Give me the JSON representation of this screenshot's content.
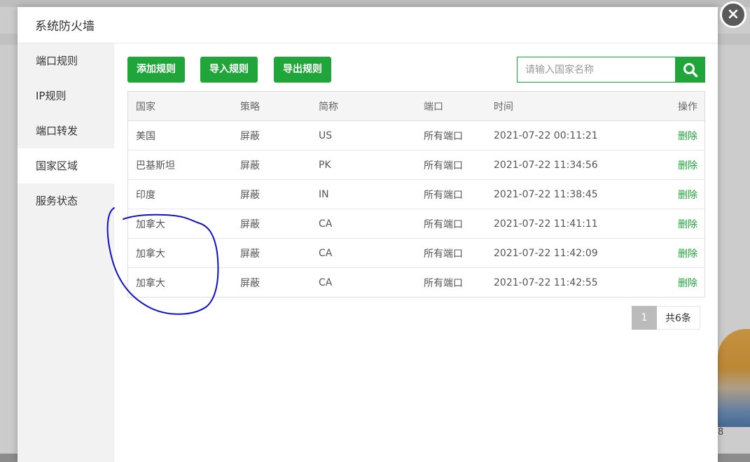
{
  "background": {
    "partial_number": "8"
  },
  "dialog": {
    "title": "系统防火墙",
    "close_symbol": "×"
  },
  "sidebar": {
    "items": [
      {
        "label": "端口规则",
        "active": false
      },
      {
        "label": "IP规则",
        "active": false
      },
      {
        "label": "端口转发",
        "active": false
      },
      {
        "label": "国家区域",
        "active": true
      },
      {
        "label": "服务状态",
        "active": false
      }
    ]
  },
  "toolbar": {
    "add_label": "添加规则",
    "import_label": "导入规则",
    "export_label": "导出规则",
    "search_placeholder": "请输入国家名称"
  },
  "table": {
    "headers": {
      "country": "国家",
      "policy": "策略",
      "abbr": "简称",
      "port": "端口",
      "time": "时间",
      "action": "操作"
    },
    "rows": [
      {
        "country": "美国",
        "policy": "屏蔽",
        "abbr": "US",
        "port": "所有端口",
        "time": "2021-07-22 00:11:21",
        "action": "删除"
      },
      {
        "country": "巴基斯坦",
        "policy": "屏蔽",
        "abbr": "PK",
        "port": "所有端口",
        "time": "2021-07-22 11:34:56",
        "action": "删除"
      },
      {
        "country": "印度",
        "policy": "屏蔽",
        "abbr": "IN",
        "port": "所有端口",
        "time": "2021-07-22 11:38:45",
        "action": "删除"
      },
      {
        "country": "加拿大",
        "policy": "屏蔽",
        "abbr": "CA",
        "port": "所有端口",
        "time": "2021-07-22 11:41:11",
        "action": "删除"
      },
      {
        "country": "加拿大",
        "policy": "屏蔽",
        "abbr": "CA",
        "port": "所有端口",
        "time": "2021-07-22 11:42:09",
        "action": "删除"
      },
      {
        "country": "加拿大",
        "policy": "屏蔽",
        "abbr": "CA",
        "port": "所有端口",
        "time": "2021-07-22 11:42:55",
        "action": "删除"
      }
    ]
  },
  "pagination": {
    "current_page": "1",
    "total_label": "共6条"
  },
  "colors": {
    "accent": "#20a53a",
    "policy_red": "#e00000",
    "annotation_ink": "#1010c8"
  }
}
